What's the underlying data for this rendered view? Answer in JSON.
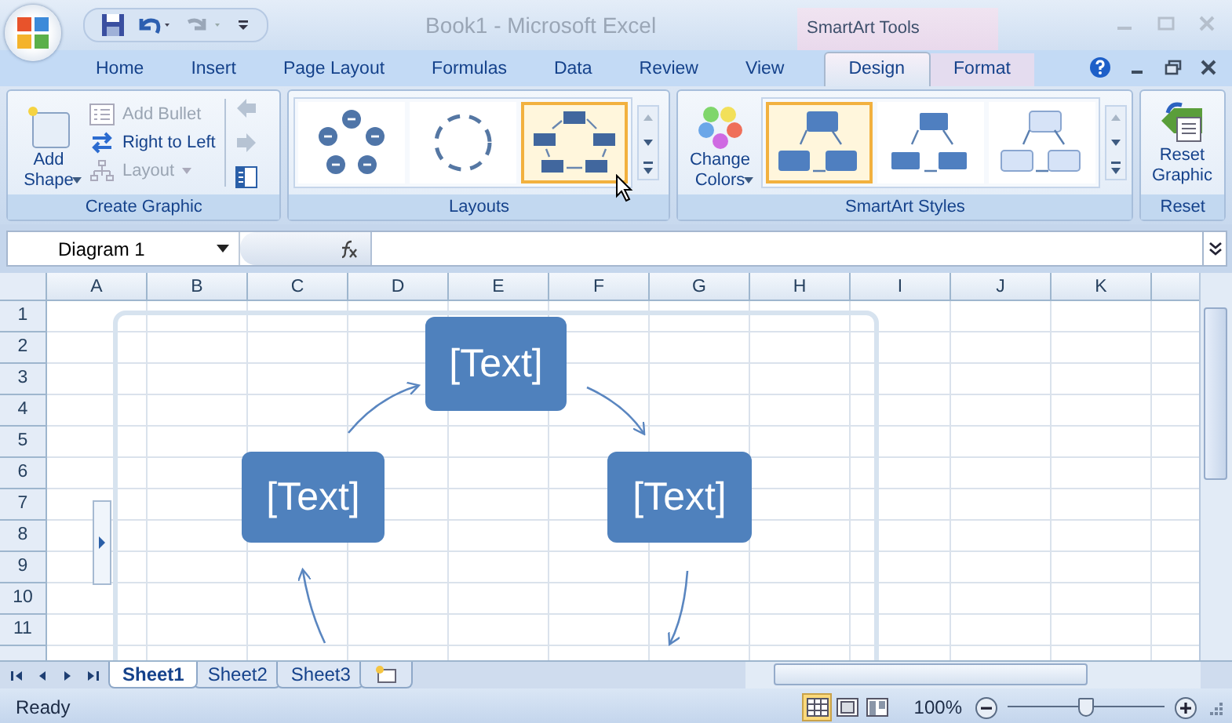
{
  "window": {
    "title": "Book1 - Microsoft Excel",
    "context_label": "SmartArt Tools"
  },
  "tabs": [
    {
      "label": "Home",
      "selected": false,
      "kind": "main"
    },
    {
      "label": "Insert",
      "selected": false,
      "kind": "main"
    },
    {
      "label": "Page Layout",
      "selected": false,
      "kind": "main"
    },
    {
      "label": "Formulas",
      "selected": false,
      "kind": "main"
    },
    {
      "label": "Data",
      "selected": false,
      "kind": "main"
    },
    {
      "label": "Review",
      "selected": false,
      "kind": "main"
    },
    {
      "label": "View",
      "selected": false,
      "kind": "main"
    },
    {
      "label": "Design",
      "selected": true,
      "kind": "contextual"
    },
    {
      "label": "Format",
      "selected": false,
      "kind": "contextual"
    }
  ],
  "create_graphic": {
    "add_shape": "Add Shape",
    "label": "Create Graphic",
    "commands": [
      {
        "label": "Add Bullet",
        "disabled": true,
        "kind": "bullet"
      },
      {
        "label": "Right to Left",
        "disabled": false,
        "kind": "swap"
      },
      {
        "label": "Layout",
        "disabled": true,
        "kind": "layout"
      }
    ]
  },
  "layouts": {
    "label": "Layouts",
    "items": [
      {
        "kind": "dots",
        "selected": false
      },
      {
        "kind": "arrows",
        "selected": false
      },
      {
        "kind": "boxes",
        "selected": true
      }
    ]
  },
  "smartart_styles": {
    "change_colors": "Change Colors",
    "label": "SmartArt Styles",
    "items": [
      {
        "kind": "flat",
        "selected": true
      },
      {
        "kind": "outlined",
        "selected": false
      },
      {
        "kind": "light",
        "selected": false
      }
    ]
  },
  "reset": {
    "button": "Reset Graphic",
    "label": "Reset"
  },
  "formula_bar": {
    "name_box": "Diagram 1"
  },
  "columns": [
    "A",
    "B",
    "C",
    "D",
    "E",
    "F",
    "G",
    "H",
    "I",
    "J",
    "K"
  ],
  "rows": [
    "1",
    "2",
    "3",
    "4",
    "5",
    "6",
    "7",
    "8",
    "9",
    "10",
    "11"
  ],
  "diagram": {
    "nodes": [
      "[Text]",
      "[Text]",
      "[Text]"
    ]
  },
  "sheets": [
    {
      "label": "Sheet1",
      "selected": true
    },
    {
      "label": "Sheet2",
      "selected": false
    },
    {
      "label": "Sheet3",
      "selected": false
    }
  ],
  "status_bar": {
    "status": "Ready",
    "views": [
      {
        "kind": "normal",
        "selected": true
      },
      {
        "kind": "page-layout",
        "selected": false
      },
      {
        "kind": "page-break",
        "selected": false
      }
    ],
    "zoom": "100%",
    "zoom_level": {
      "level": 0.5
    }
  }
}
